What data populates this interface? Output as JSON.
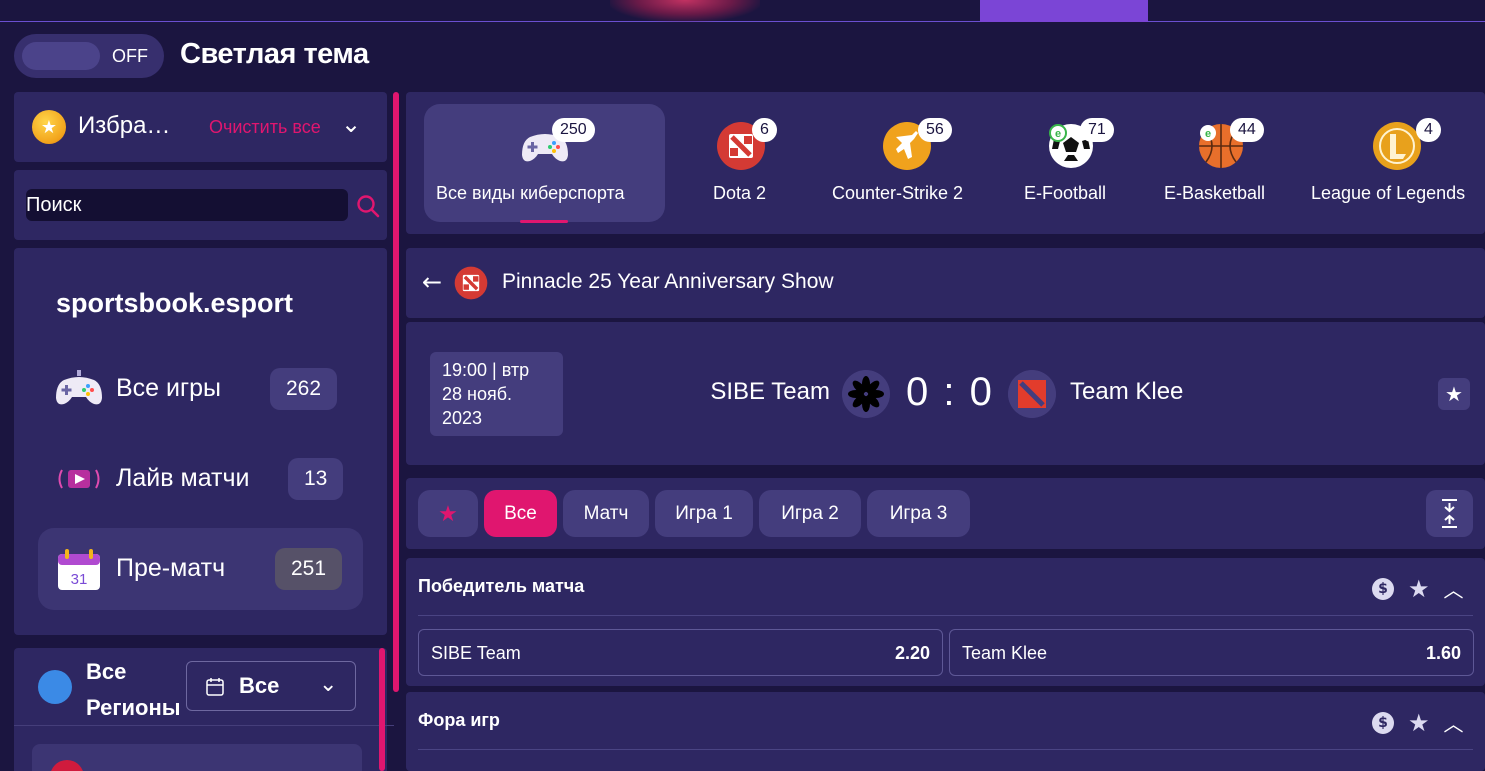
{
  "theme": {
    "toggle_state": "OFF",
    "label": "Светлая тема"
  },
  "favorites": {
    "title": "Избра…",
    "clear_label": "Очистить все"
  },
  "search": {
    "placeholder": "Поиск"
  },
  "menu": {
    "brand": "sportsbook.esport",
    "items": [
      {
        "label": "Все игры",
        "count": "262",
        "icon": "gamepad-icon"
      },
      {
        "label": "Лайв матчи",
        "count": "13",
        "icon": "live-icon"
      },
      {
        "label": "Пре-матч",
        "count": "251",
        "icon": "calendar-icon"
      }
    ]
  },
  "regions": {
    "label_line1": "Все",
    "label_line2": "Регионы",
    "select_value": "Все"
  },
  "games": [
    {
      "label": "Все виды киберспорта",
      "count": "250",
      "icon": "gamepad-icon"
    },
    {
      "label": "Dota 2",
      "count": "6",
      "icon": "dota-icon"
    },
    {
      "label": "Counter-Strike 2",
      "count": "56",
      "icon": "cs-icon"
    },
    {
      "label": "E-Football",
      "count": "71",
      "icon": "football-icon"
    },
    {
      "label": "E-Basketball",
      "count": "44",
      "icon": "basketball-icon"
    },
    {
      "label": "League of Legends",
      "count": "4",
      "icon": "lol-icon"
    }
  ],
  "event": {
    "tournament": "Pinnacle 25 Year Anniversary Show",
    "time_line1": "19:00 | втр",
    "time_line2": "28 нояб.",
    "time_line3": "2023",
    "team1": "SIBE Team",
    "team2": "Team Klee",
    "score": "0 : 0"
  },
  "filters": [
    "Все",
    "Матч",
    "Игра 1",
    "Игра 2",
    "Игра 3"
  ],
  "markets": [
    {
      "title": "Победитель матча",
      "odds": [
        {
          "label": "SIBE Team",
          "value": "2.20"
        },
        {
          "label": "Team Klee",
          "value": "1.60"
        }
      ]
    },
    {
      "title": "Фора игр"
    }
  ],
  "colors": {
    "accent": "#e0166f",
    "panel": "#2e2762",
    "background": "#1b1540"
  }
}
